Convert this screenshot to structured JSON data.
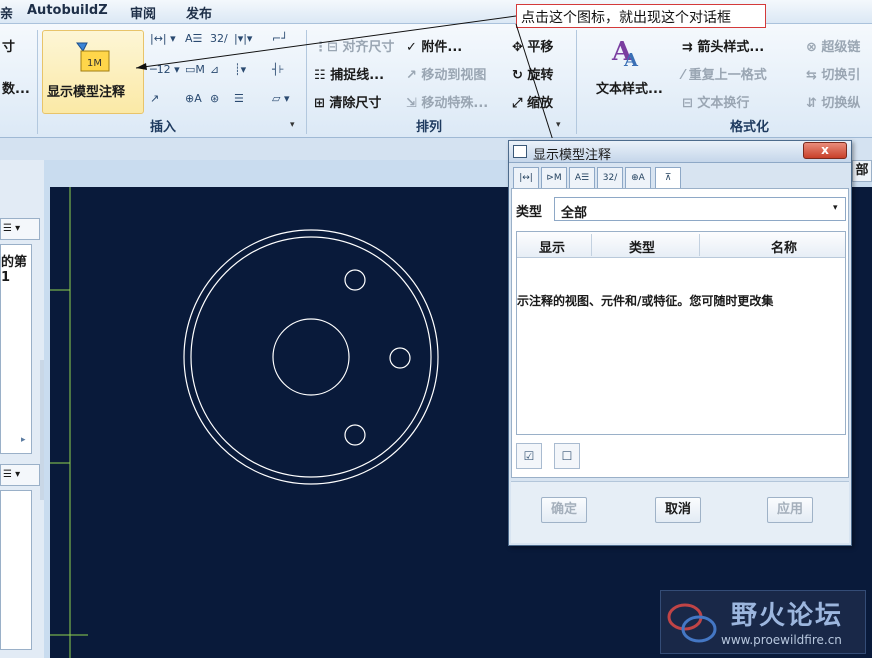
{
  "menubar": {
    "items": [
      "亲",
      "AutobuildZ",
      "审阅",
      "发布"
    ]
  },
  "callout": {
    "text": "点击这个图标，就出现这个对话框"
  },
  "ribbon": {
    "big_button": {
      "label": "显示模型注释"
    },
    "insert_group": {
      "label": "插入",
      "left_partial_top": "寸",
      "left_partial_bottom": "数..."
    },
    "arrange_group": {
      "label": "排列",
      "items": [
        {
          "label": "对齐尺寸",
          "enabled": false
        },
        {
          "label": "附件...",
          "enabled": true
        },
        {
          "label": "平移",
          "enabled": true
        },
        {
          "label": "捕捉线...",
          "enabled": true
        },
        {
          "label": "移动到视图",
          "enabled": false
        },
        {
          "label": "旋转",
          "enabled": true
        },
        {
          "label": "清除尺寸",
          "enabled": true
        },
        {
          "label": "移动特殊...",
          "enabled": false
        },
        {
          "label": "缩放",
          "enabled": true
        }
      ]
    },
    "format_group": {
      "label": "格式化",
      "text_style": "文本样式...",
      "items": [
        {
          "label": "箭头样式...",
          "enabled": true
        },
        {
          "label": "超级链",
          "enabled": false
        },
        {
          "label": "重复上一格式",
          "enabled": false
        },
        {
          "label": "切换引",
          "enabled": false
        },
        {
          "label": "文本换行",
          "enabled": false
        },
        {
          "label": "切换纵",
          "enabled": false
        }
      ]
    },
    "insert_icons": [
      "32/"
    ]
  },
  "left_panel": {
    "tree_text": "的第 1"
  },
  "dialog": {
    "title": "显示模型注释",
    "close_label": "x",
    "tabs": [
      "|↔|",
      "⊳M",
      "A☰",
      "32/",
      "⊕A",
      "⊼"
    ],
    "type_label": "类型",
    "type_value": "全部",
    "columns": [
      "显示",
      "类型",
      "名称"
    ],
    "message": "示注释的视图、元件和/或特征。您可随时更改集",
    "buttons": [
      {
        "label": "确定",
        "enabled": false
      },
      {
        "label": "取消",
        "enabled": true
      },
      {
        "label": "应用",
        "enabled": false
      }
    ]
  },
  "right_edge": {
    "partial_text": "部"
  },
  "watermark": {
    "title": "野火论坛",
    "url": "www.proewildfire.cn"
  }
}
